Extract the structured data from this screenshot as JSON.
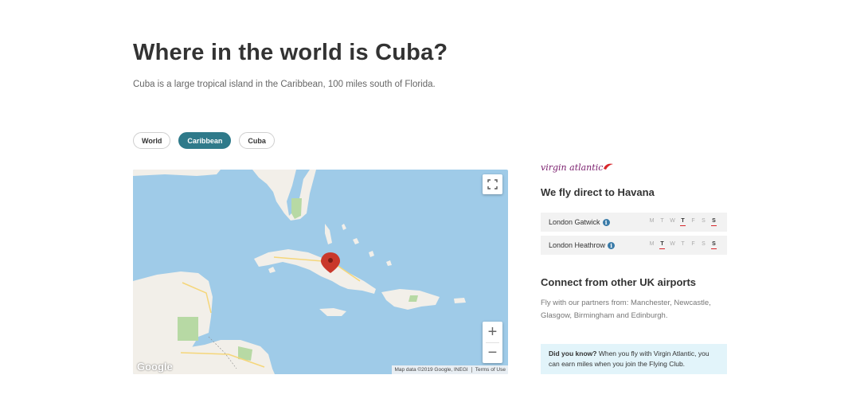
{
  "page": {
    "title": "Where in the world is Cuba?",
    "subtitle": "Cuba is a large tropical island in the Caribbean, 100 miles south of Florida."
  },
  "map_tabs": [
    {
      "label": "World",
      "active": false
    },
    {
      "label": "Caribbean",
      "active": true
    },
    {
      "label": "Cuba",
      "active": false
    }
  ],
  "map": {
    "provider_logo": "Google",
    "attribution": "Map data ©2019 Google, INEGI",
    "terms_link": "Terms of Use",
    "zoom_in_label": "+",
    "zoom_out_label": "−",
    "fullscreen_icon": "fullscreen-icon",
    "marker_icon": "map-pin-icon",
    "colors": {
      "water": "#9fcbe8",
      "land": "#f2efe9",
      "park": "#b7d9a4",
      "road": "#f5d67a",
      "marker": "#c9382b"
    }
  },
  "panel": {
    "brand_logo": "virgin atlantic",
    "direct_heading": "We fly direct to Havana",
    "routes": [
      {
        "airport": "London Gatwick",
        "days": [
          {
            "letter": "M",
            "flies": false
          },
          {
            "letter": "T",
            "flies": false
          },
          {
            "letter": "W",
            "flies": false
          },
          {
            "letter": "T",
            "flies": true
          },
          {
            "letter": "F",
            "flies": false
          },
          {
            "letter": "S",
            "flies": false
          },
          {
            "letter": "S",
            "flies": true
          }
        ]
      },
      {
        "airport": "London Heathrow",
        "days": [
          {
            "letter": "M",
            "flies": false
          },
          {
            "letter": "T",
            "flies": true
          },
          {
            "letter": "W",
            "flies": false
          },
          {
            "letter": "T",
            "flies": false
          },
          {
            "letter": "F",
            "flies": false
          },
          {
            "letter": "S",
            "flies": false
          },
          {
            "letter": "S",
            "flies": true
          }
        ]
      }
    ],
    "connect_heading": "Connect from other UK airports",
    "connect_text": "Fly with our partners from: Manchester, Newcastle, Glasgow, Birmingham and Edinburgh.",
    "did_you_know_label": "Did you know?",
    "did_you_know_text": " When you fly with Virgin Atlantic, you can earn miles when you join the Flying Club.",
    "accent_color": "#2f7a8a",
    "day_underline_color": "#d8262b",
    "info_background": "#e2f4fa"
  }
}
